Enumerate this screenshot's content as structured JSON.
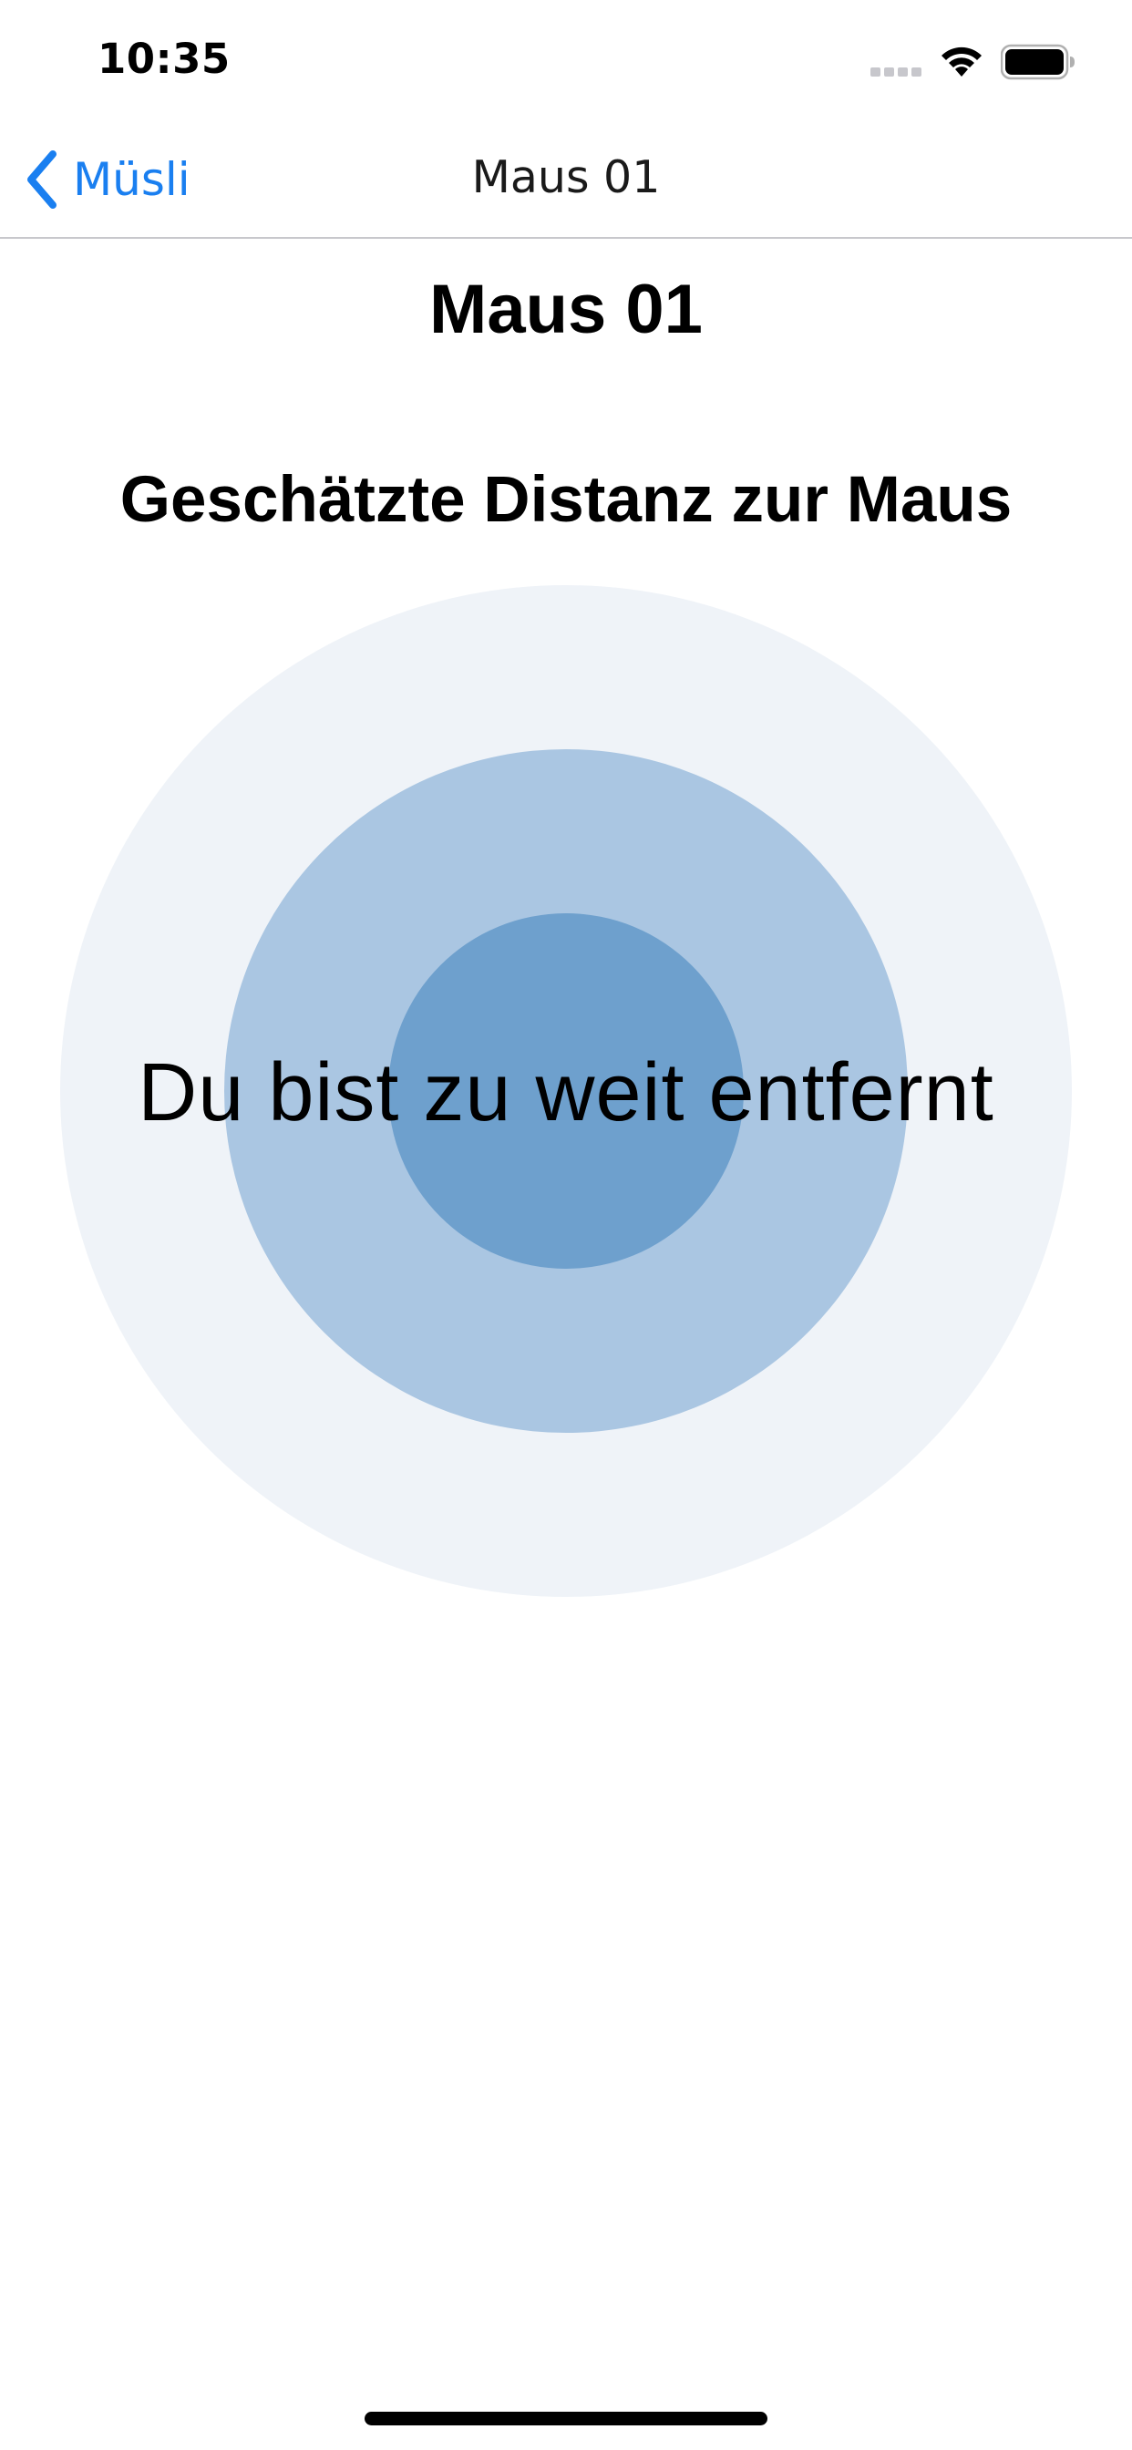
{
  "status_bar": {
    "time": "10:35",
    "icons": [
      "signal-icon",
      "wifi-icon",
      "battery-icon"
    ]
  },
  "nav": {
    "back_label": "Müsli",
    "title": "Maus 01"
  },
  "main": {
    "title": "Maus 01",
    "section_heading": "Geschätzte Distanz zur Maus",
    "distance_message": "Du bist zu weit entfernt"
  },
  "colors": {
    "accent": "#1a7ff0",
    "ring_outer": "#eff3f8",
    "ring_middle": "#aac6e2",
    "ring_inner": "#6ea0cd"
  }
}
